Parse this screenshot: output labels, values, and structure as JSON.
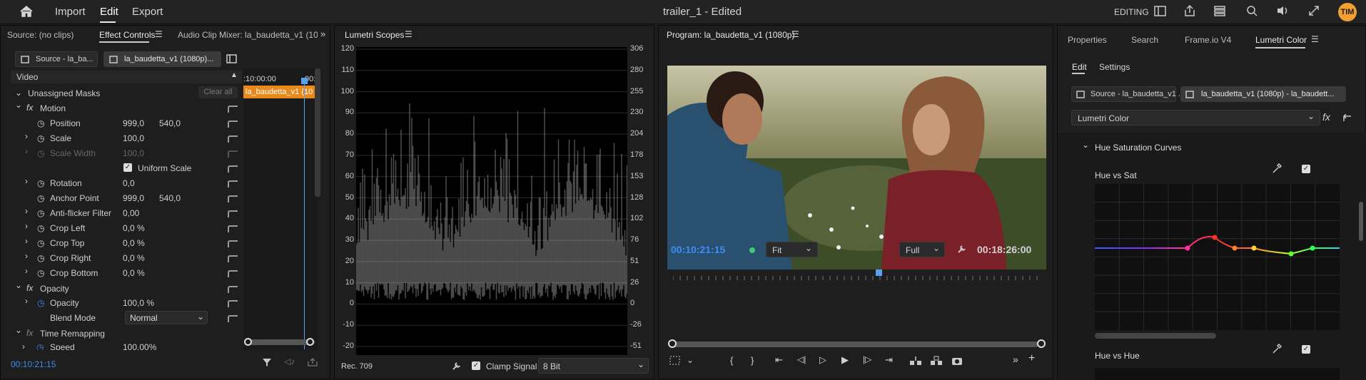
{
  "top": {
    "import": "Import",
    "edit": "Edit",
    "export": "Export",
    "title": "trailer_1 - Edited",
    "workspace": "EDITING",
    "avatar": "TIM"
  },
  "left": {
    "tabs": [
      "Source: (no clips)",
      "Effect Controls",
      "Audio Clip Mixer: la_baudetta_v1 (1080"
    ],
    "source_btn": "Source - la_ba...",
    "seq_btn": "la_baudetta_v1 (1080p)...",
    "timecode_ruler": ":10:00:00",
    "timecode_ruler2": "00:",
    "clip_label": "la_baudetta_v1 (10",
    "video": "Video",
    "unassigned": "Unassigned Masks",
    "clear_all": "Clear all",
    "motion": "Motion",
    "position": "Position",
    "pos_x": "999,0",
    "pos_y": "540,0",
    "scale": "Scale",
    "scale_v": "100,0",
    "scale_width": "Scale Width",
    "scale_width_v": "100,0",
    "uniform": "Uniform Scale",
    "rotation": "Rotation",
    "rotation_v": "0,0",
    "anchor": "Anchor Point",
    "anch_x": "999,0",
    "anch_y": "540,0",
    "antiflicker": "Anti-flicker Filter",
    "antiflicker_v": "0,00",
    "crop_left": "Crop Left",
    "crop_left_v": "0,0 %",
    "crop_top": "Crop Top",
    "crop_top_v": "0,0 %",
    "crop_right": "Crop Right",
    "crop_right_v": "0,0 %",
    "crop_bottom": "Crop Bottom",
    "crop_bottom_v": "0,0 %",
    "opacity": "Opacity",
    "opacity_p": "Opacity",
    "opacity_v": "100,0 %",
    "blend": "Blend Mode",
    "blend_v": "Normal",
    "time_remap": "Time Remapping",
    "speed": "Speed",
    "speed_v": "100,00%",
    "timecode": "00:10:21:15",
    "fx": "fx"
  },
  "scopes": {
    "tab": "Lumetri Scopes",
    "left_ticks": [
      "120",
      "110",
      "100",
      "90",
      "80",
      "70",
      "60",
      "50",
      "40",
      "30",
      "20",
      "10",
      "0",
      "-10",
      "-20"
    ],
    "right_ticks": [
      "306",
      "280",
      "255",
      "230",
      "204",
      "178",
      "153",
      "128",
      "102",
      "76",
      "51",
      "26",
      "0",
      "-26",
      "-51"
    ],
    "colorspace": "Rec. 709",
    "clamp": "Clamp Signal",
    "bits": "8 Bit"
  },
  "program": {
    "tab": "Program: la_baudetta_v1 (1080p)",
    "timecode": "00:10:21:15",
    "fit": "Fit",
    "full": "Full",
    "duration": "00:18:26:00"
  },
  "right": {
    "tabs": [
      "Properties",
      "Search",
      "Frame.io V4",
      "Lumetri Color"
    ],
    "edit": "Edit",
    "settings": "Settings",
    "src": "Source - la_baudetta_v1 ...",
    "seq": "la_baudetta_v1 (1080p) - la_baudett...",
    "effect": "Lumetri Color",
    "section": "Hue Saturation Curves",
    "huesat": "Hue vs Sat",
    "huehue": "Hue vs Hue"
  },
  "colors": {
    "accent": "#3d8df5",
    "clip": "#e8891c",
    "avatar": "#f0a030",
    "playhead": "#5aa0f0"
  }
}
